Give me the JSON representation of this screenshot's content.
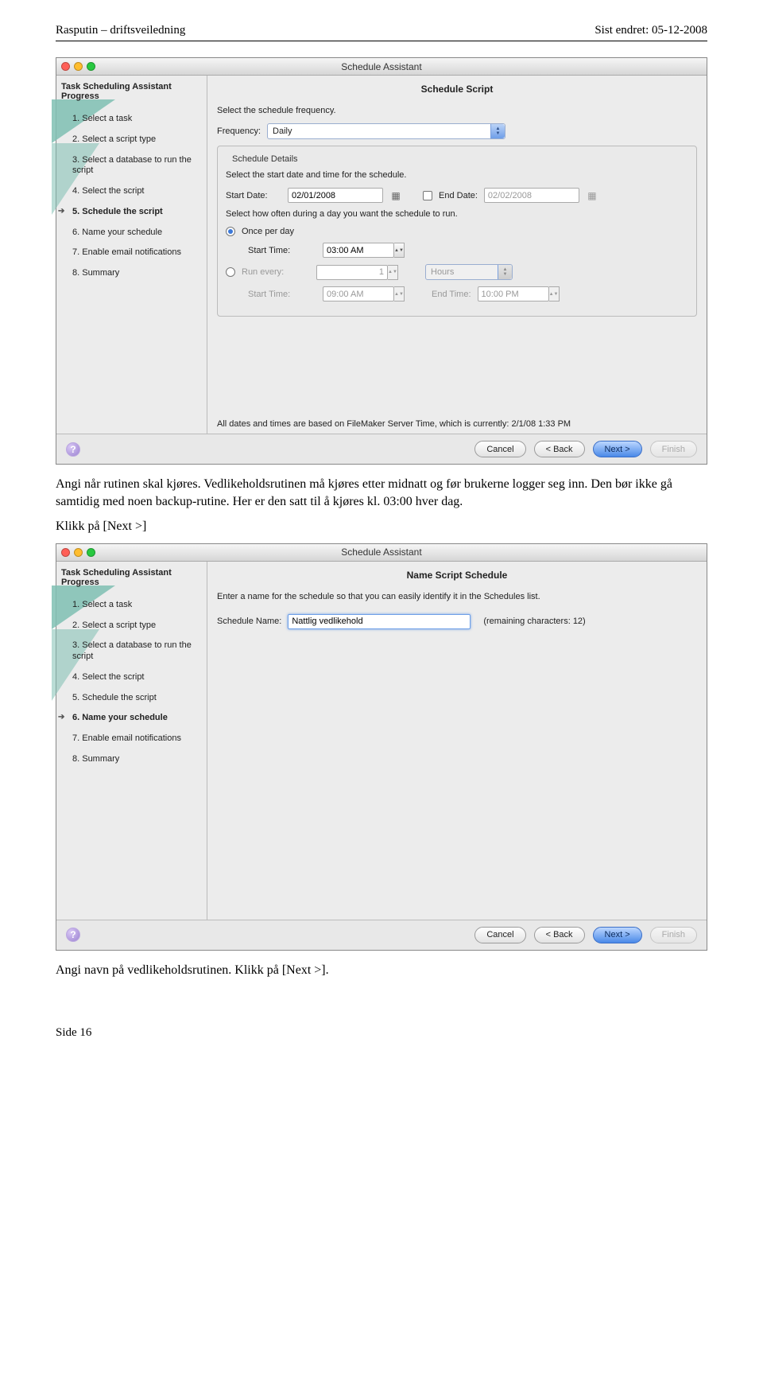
{
  "doc": {
    "left": "Rasputin – driftsveiledning",
    "right": "Sist endret: 05-12-2008",
    "page": "Side 16"
  },
  "para1": "Angi når rutinen skal kjøres. Vedlikeholdsrutinen må kjøres etter midnatt og før brukerne logger seg inn. Den bør ikke gå samtidig med noen backup-rutine. Her er den satt til å kjøres kl. 03:00 hver dag.",
  "para1b": "Klikk på [Next >]",
  "para2": "Angi navn på vedlikeholdsrutinen. Klikk på [Next >].",
  "wnd": {
    "title": "Schedule Assistant",
    "sidebar_title": "Task Scheduling Assistant Progress",
    "steps": [
      "1. Select a task",
      "2. Select a script type",
      "3. Select a database to run the script",
      "4. Select the script",
      "5. Schedule the script",
      "6. Name your schedule",
      "7. Enable email notifications",
      "8. Summary"
    ],
    "footer": {
      "cancel": "Cancel",
      "back": "< Back",
      "next": "Next >",
      "finish": "Finish"
    }
  },
  "screen1": {
    "title": "Schedule Script",
    "instr_freq": "Select the schedule frequency.",
    "freq_label": "Frequency:",
    "freq_value": "Daily",
    "details_legend": "Schedule Details",
    "instr_start": "Select the start date and time for the schedule.",
    "start_date_label": "Start Date:",
    "start_date": "02/01/2008",
    "end_date_label": "End Date:",
    "end_date": "02/02/2008",
    "instr_often": "Select how often during a day you want the schedule to run.",
    "once_label": "Once per day",
    "start_time_label": "Start Time:",
    "start_time": "03:00 AM",
    "run_every_label": "Run every:",
    "run_every_value": "1",
    "run_every_unit": "Hours",
    "re_start_time_label": "Start Time:",
    "re_start_time": "09:00 AM",
    "re_end_time_label": "End Time:",
    "re_end_time": "10:00 PM",
    "note": "All dates and times are based on FileMaker Server Time, which is currently: 2/1/08 1:33 PM"
  },
  "screen2": {
    "title": "Name Script Schedule",
    "instr": "Enter a name for the schedule so that you can easily identify it in the Schedules list.",
    "name_label": "Schedule Name:",
    "name_value": "Nattlig vedlikehold",
    "remaining": "(remaining characters:   12)"
  }
}
